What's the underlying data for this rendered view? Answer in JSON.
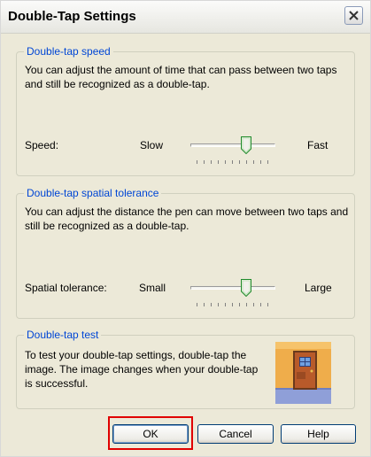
{
  "window": {
    "title": "Double-Tap Settings"
  },
  "speed_group": {
    "title": "Double-tap speed",
    "description": "You can adjust the amount of time that can pass between two taps and still be recognized as a double-tap.",
    "label": "Speed:",
    "min_label": "Slow",
    "max_label": "Fast",
    "value_fraction": 0.63
  },
  "spatial_group": {
    "title": "Double-tap spatial tolerance",
    "description": "You can adjust the distance the pen can move between two taps and still be recognized as a double-tap.",
    "label": "Spatial tolerance:",
    "min_label": "Small",
    "max_label": "Large",
    "value_fraction": 0.63
  },
  "test_group": {
    "title": "Double-tap test",
    "description": "To test your double-tap settings, double-tap the image. The image changes when your double-tap is successful."
  },
  "buttons": {
    "ok": "OK",
    "cancel": "Cancel",
    "help": "Help"
  },
  "colors": {
    "group_title": "#0046d5",
    "highlight": "#e00000",
    "window_bg": "#ece9d8"
  }
}
